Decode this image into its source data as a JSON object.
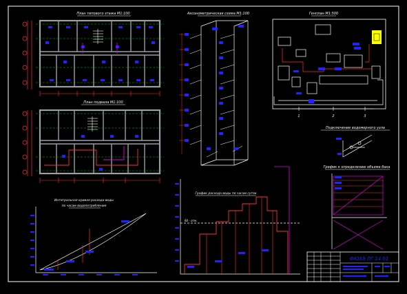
{
  "colors": {
    "background": "#000000",
    "frame": "#ffffff",
    "wall": "#9aa0a6",
    "axis": "#ff3030",
    "pipe": "#2222ff",
    "green": "#00c000",
    "magenta": "#e000e0",
    "yellow": "#ffff00",
    "label": "#ffffff"
  },
  "titles": {
    "plan_typical": "План типового этажа М1:100",
    "plan_basement": "План подвала М1:100",
    "axonometric": "Аксонометрическая схема М1:100",
    "genplan": "Генплан М1:500",
    "graph_left_1": "Интегральная кривая расхода воды",
    "graph_left_2": "по часам водопотребления",
    "graph_center": "График расхода воды по часам суток",
    "graph_right_top": "Подключение водомерного узла",
    "graph_right_mid": "График к определению объема бака",
    "water_level": "60 - отм.",
    "stamp_code": "ФЮЗЭ ЛГ 14.01"
  },
  "genplan_axes": [
    "1",
    "2",
    "3"
  ]
}
